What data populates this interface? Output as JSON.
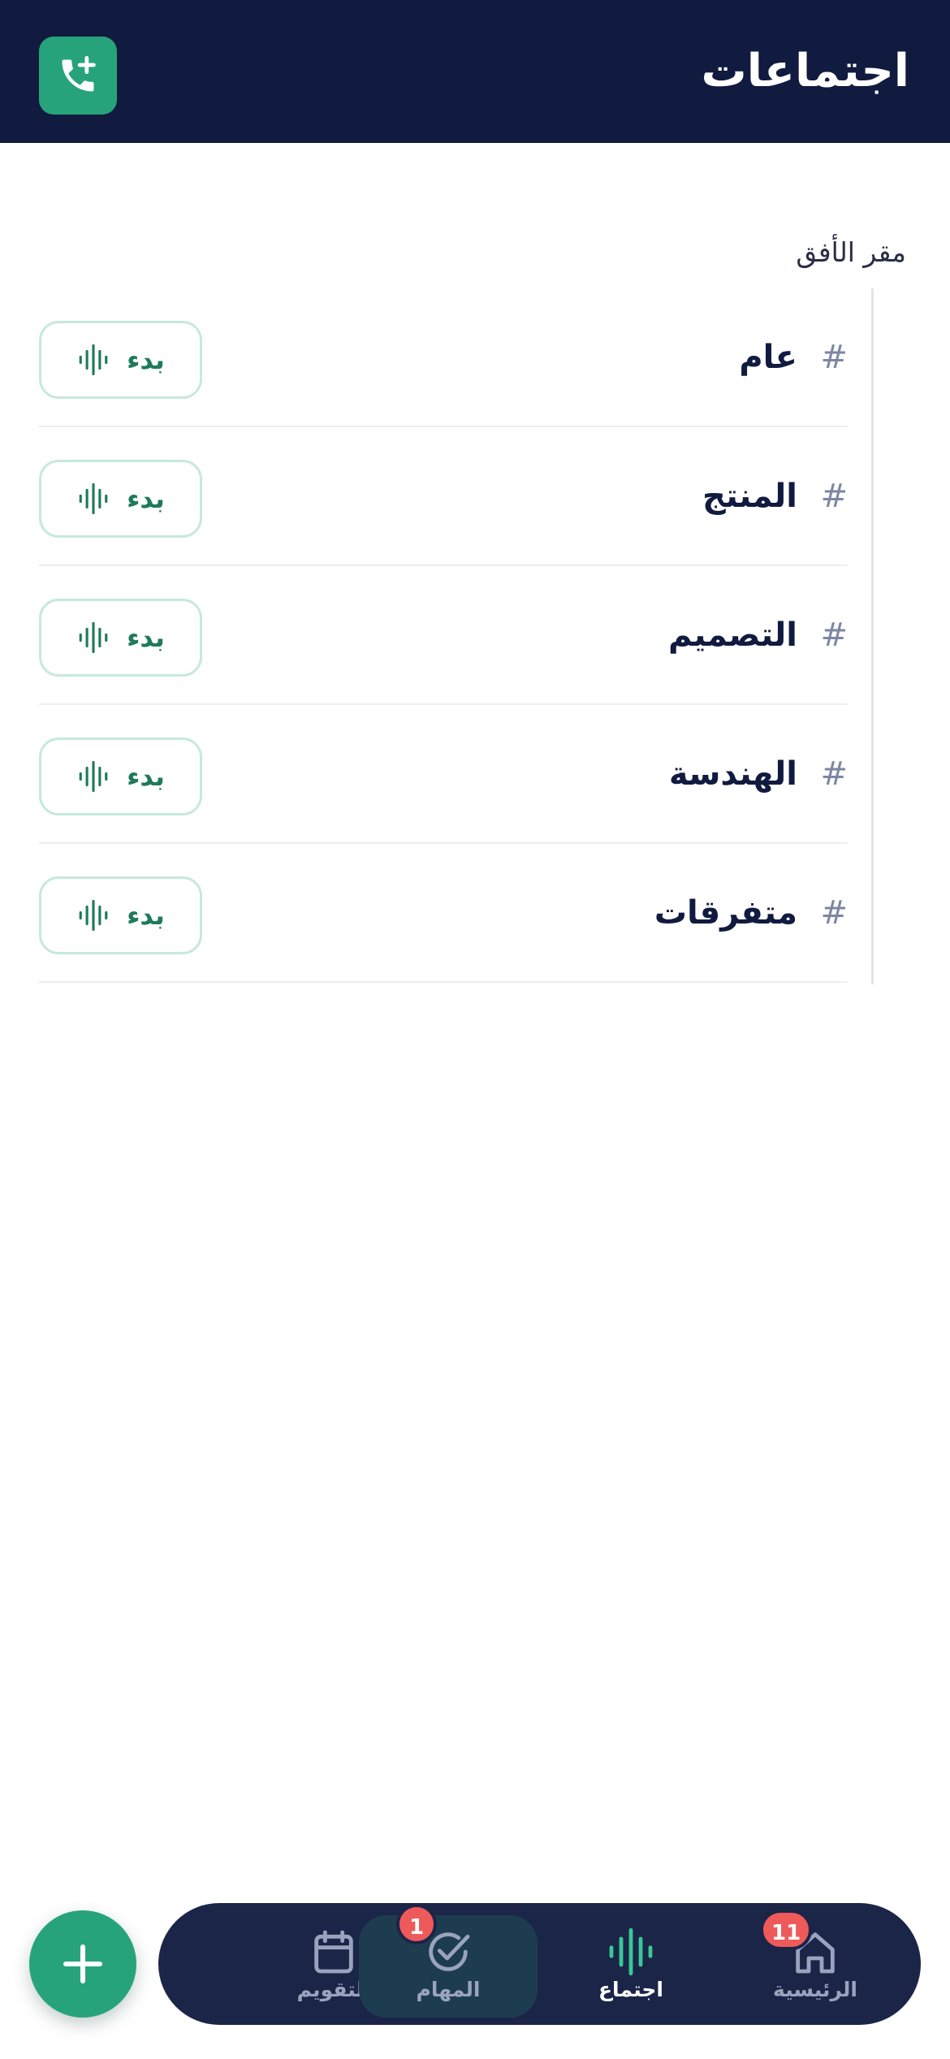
{
  "header": {
    "title": "اجتماعات",
    "add_call_icon": "phone-plus-icon"
  },
  "workspace": {
    "name": "مقر الأفق"
  },
  "channels": [
    {
      "hash": "#",
      "name": "عام",
      "button_label": "بدء"
    },
    {
      "hash": "#",
      "name": "المنتج",
      "button_label": "بدء"
    },
    {
      "hash": "#",
      "name": "التصميم",
      "button_label": "بدء"
    },
    {
      "hash": "#",
      "name": "الهندسة",
      "button_label": "بدء"
    },
    {
      "hash": "#",
      "name": "متفرقات",
      "button_label": "بدء"
    }
  ],
  "fab": {
    "icon": "plus-icon"
  },
  "nav": {
    "home": {
      "label": "الرئيسية",
      "badge": "11",
      "icon": "home-icon"
    },
    "meeting": {
      "label": "اجتماع",
      "icon": "waveform-icon"
    },
    "tasks": {
      "label": "المهام",
      "badge": "1",
      "icon": "check-circle-icon"
    },
    "calendar": {
      "label": "التقويم",
      "icon": "calendar-icon"
    }
  },
  "colors": {
    "header_bg": "#111a3f",
    "accent": "#27a37c",
    "nav_bg": "#1b2548",
    "badge": "#ee5a5a"
  }
}
